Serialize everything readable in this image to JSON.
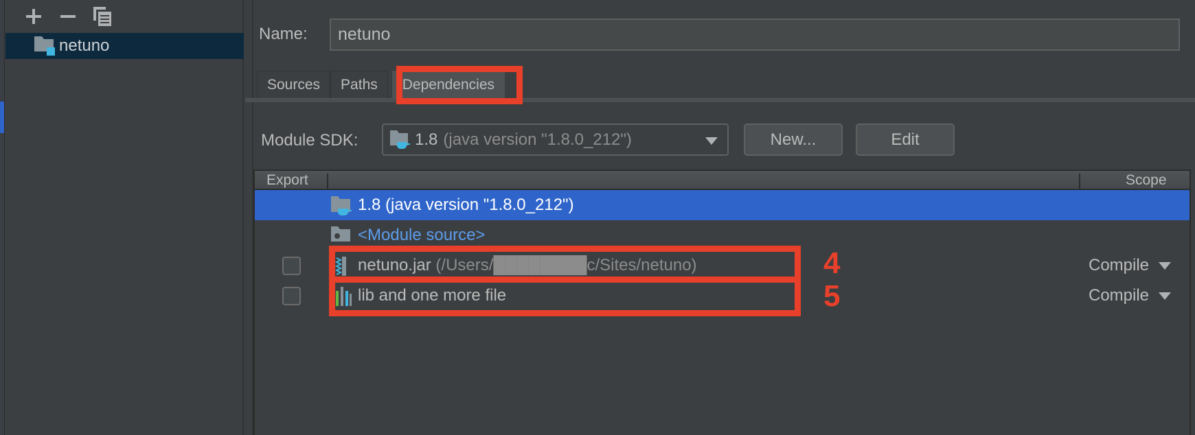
{
  "sidebar": {
    "toolbar": {
      "add_icon": "plus-icon",
      "remove_icon": "minus-icon",
      "copy_icon": "copy-icon"
    },
    "modules": [
      {
        "label": "netuno",
        "icon": "module-folder-icon",
        "selected": true
      }
    ]
  },
  "main": {
    "name_label": "Name:",
    "name_value": "netuno",
    "tabs": [
      {
        "label": "Sources",
        "active": false
      },
      {
        "label": "Paths",
        "active": false
      },
      {
        "label": "Dependencies",
        "active": true
      }
    ],
    "sdk": {
      "label": "Module SDK:",
      "value_main": "1.8",
      "value_detail": "(java version \"1.8.0_212\")",
      "new_button": "New...",
      "edit_button": "Edit"
    },
    "table": {
      "headers": {
        "export": "Export",
        "scope": "Scope"
      },
      "rows": [
        {
          "icon": "jdk-folder-icon",
          "name": "1.8 (java version \"1.8.0_212\")",
          "path": "",
          "selected": true,
          "has_checkbox": false,
          "scope": ""
        },
        {
          "icon": "module-source-folder-icon",
          "name": "<Module source>",
          "path": "",
          "selected": false,
          "has_checkbox": false,
          "scope": ""
        },
        {
          "icon": "jar-archive-icon",
          "name": "netuno.jar",
          "path": "(/Users/████████c/Sites/netuno)",
          "selected": false,
          "has_checkbox": true,
          "checked": false,
          "scope": "Compile"
        },
        {
          "icon": "library-icon",
          "name": "lib and one more file",
          "path": "",
          "selected": false,
          "has_checkbox": true,
          "checked": false,
          "scope": "Compile"
        }
      ]
    }
  },
  "annotations": {
    "labels": [
      "4",
      "5"
    ],
    "color": "#e8402a"
  },
  "colors": {
    "selection": "#2f65ca",
    "module_source_link": "#5c9ced",
    "background": "#3c3f41"
  }
}
